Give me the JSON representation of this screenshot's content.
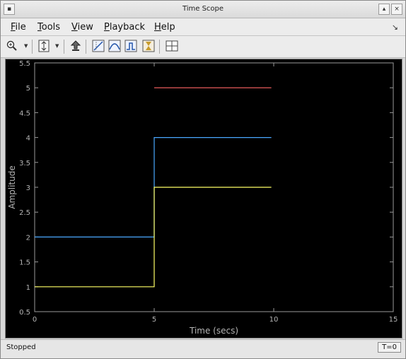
{
  "window": {
    "title": "Time Scope"
  },
  "menu": {
    "items": [
      {
        "label": "File",
        "mnemonic": "F",
        "rest": "ile"
      },
      {
        "label": "Tools",
        "mnemonic": "T",
        "rest": "ools"
      },
      {
        "label": "View",
        "mnemonic": "V",
        "rest": "iew"
      },
      {
        "label": "Playback",
        "mnemonic": "P",
        "rest": "layback"
      },
      {
        "label": "Help",
        "mnemonic": "H",
        "rest": "elp"
      }
    ]
  },
  "toolbar": {
    "icons": [
      "zoom-in-icon",
      "autoscale-icon",
      "highlight-icon",
      "cursor-measure-icon",
      "signal-stats-icon",
      "peak-finder-icon",
      "bilevel-measure-icon",
      "trigger-icon",
      "layout-icon"
    ]
  },
  "chart_data": {
    "type": "line",
    "xlabel": "Time (secs)",
    "ylabel": "Amplitude",
    "xlim": [
      0,
      15
    ],
    "ylim": [
      0.5,
      5.5
    ],
    "xticks": [
      "0",
      "5",
      "10",
      "15"
    ],
    "yticks": [
      "0.5",
      "1",
      "1.5",
      "2",
      "2.5",
      "3",
      "3.5",
      "4",
      "4.5",
      "5",
      "5.5"
    ],
    "background": "#000000",
    "series": [
      {
        "color": "#4aa8ff",
        "x": [
          0,
          5,
          5,
          9.9
        ],
        "y": [
          2,
          2,
          4,
          4
        ]
      },
      {
        "color": "#ffff66",
        "x": [
          0,
          5,
          5,
          9.9
        ],
        "y": [
          1,
          1,
          3,
          3
        ]
      },
      {
        "color": "#ff6666",
        "x": [
          5,
          9.9
        ],
        "y": [
          5,
          5
        ]
      }
    ]
  },
  "status": {
    "text": "Stopped",
    "time": "T=0"
  }
}
